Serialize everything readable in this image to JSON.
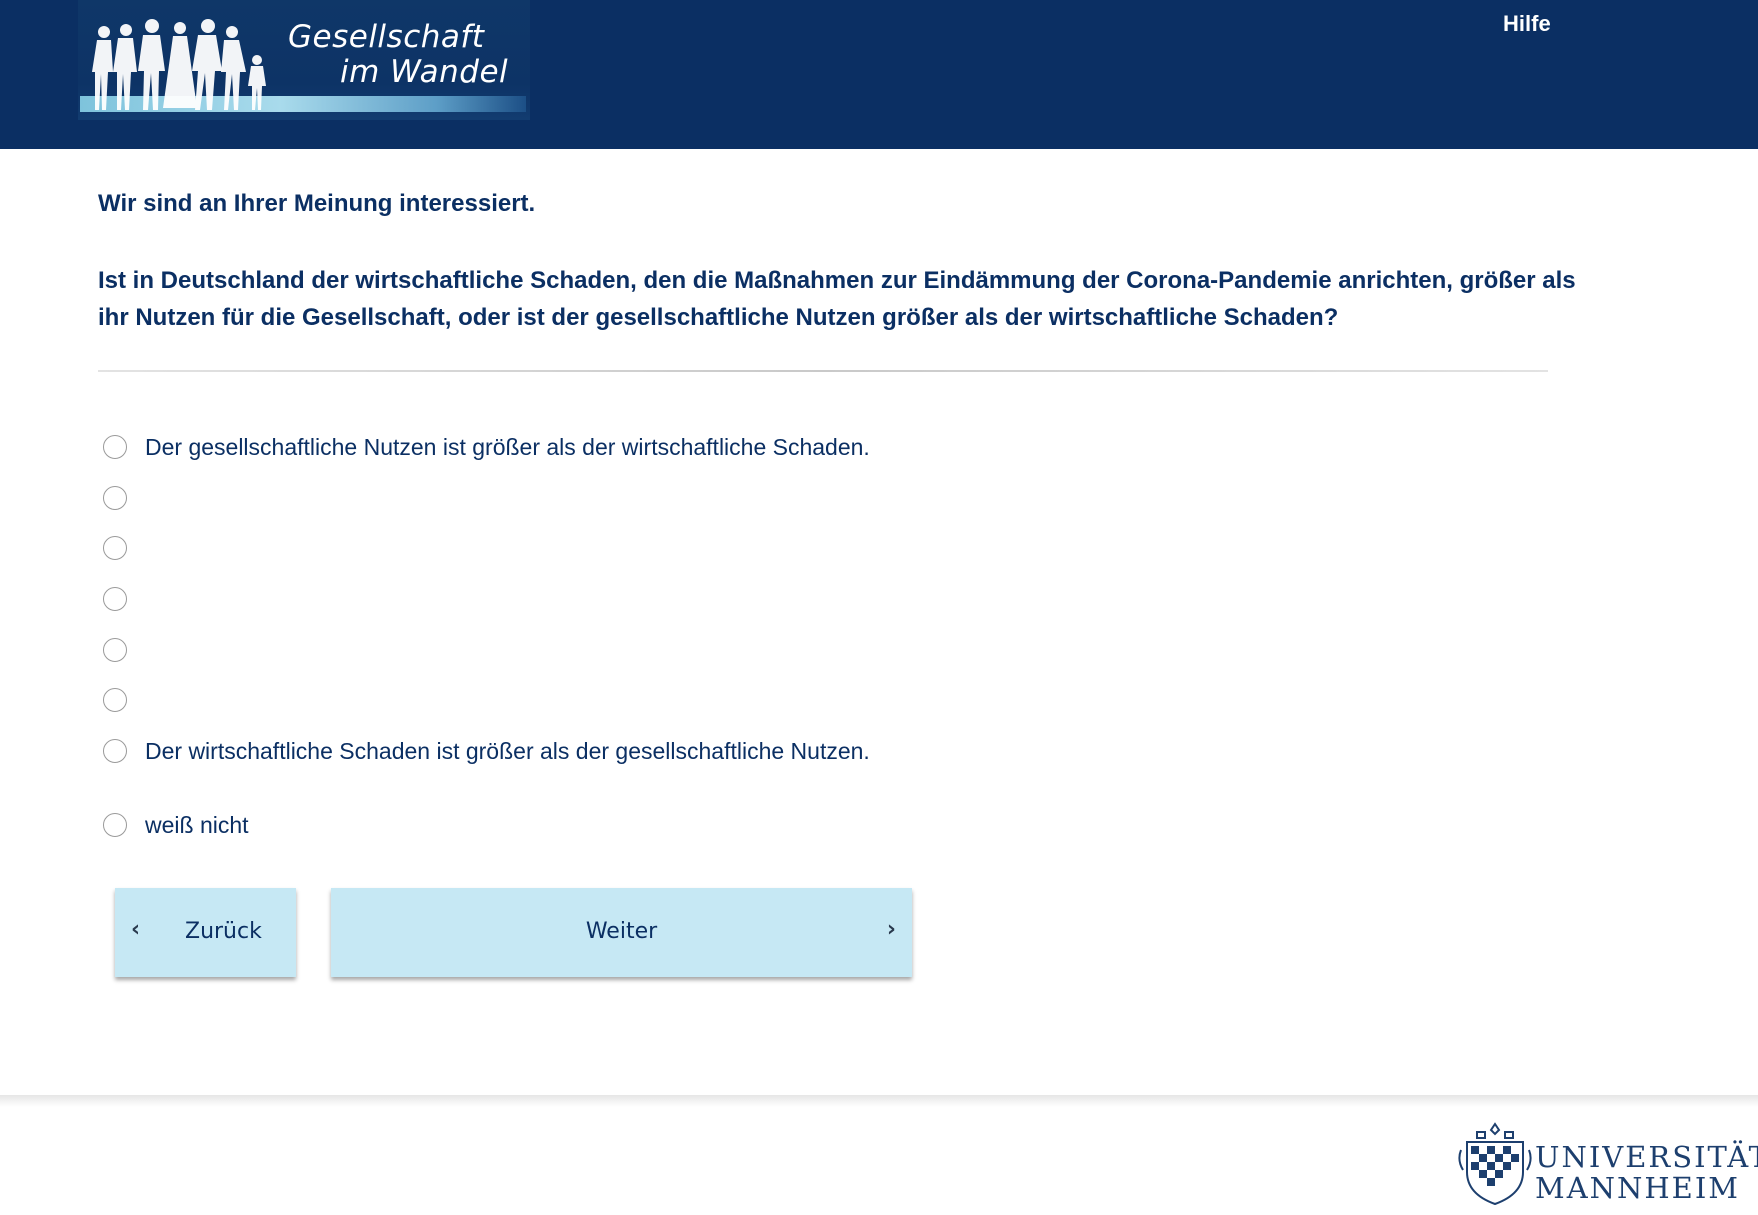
{
  "header": {
    "logo_line1": "Gesellschaft",
    "logo_line2": "im Wandel",
    "help_label": "Hilfe"
  },
  "survey": {
    "intro": "Wir sind an Ihrer Meinung interessiert.",
    "question": "Ist in Deutschland der wirtschaftliche Schaden, den die Maßnahmen zur Eindämmung der Corona-Pandemie anrichten, größer als ihr Nutzen für die Gesellschaft, oder ist der gesellschaftliche Nutzen größer als der wirtschaftliche Schaden?",
    "options": [
      {
        "label": "Der gesellschaftliche Nutzen ist größer als der wirtschaftliche Schaden.",
        "selected": false
      },
      {
        "label": "",
        "selected": false
      },
      {
        "label": "",
        "selected": false
      },
      {
        "label": "",
        "selected": false
      },
      {
        "label": "",
        "selected": false
      },
      {
        "label": "",
        "selected": false
      },
      {
        "label": "Der wirtschaftliche Schaden ist größer als der gesellschaftliche Nutzen.",
        "selected": false
      },
      {
        "label": "weiß nicht",
        "selected": false
      }
    ]
  },
  "navigation": {
    "back_label": "Zurück",
    "next_label": "Weiter"
  },
  "footer": {
    "university_line1": "UNIVERSITÄT",
    "university_line2": "MANNHEIM"
  },
  "colors": {
    "brand_navy": "#0b2f63",
    "button_bg": "#c6e8f4"
  }
}
